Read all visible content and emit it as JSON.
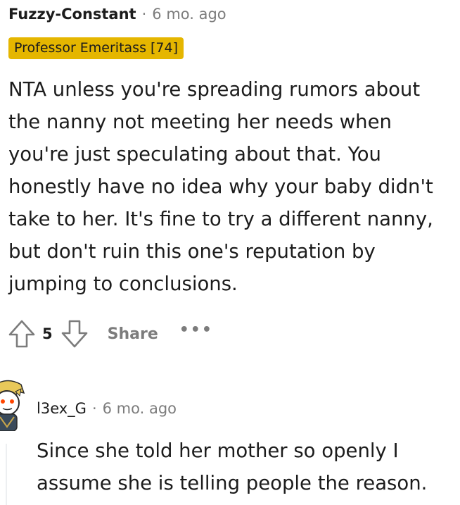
{
  "comment": {
    "author": "Fuzzy-Constant",
    "separator": "·",
    "time": "6 mo. ago",
    "flair": "Professor Emeritass [74]",
    "body": "NTA unless you're spreading rumors about the nanny not meeting her needs when you're just speculating about that. You honestly have no idea why your baby didn't take to her. It's fine to try a different nanny, but don't ruin this one's reputation by jumping to conclusions.",
    "score": "5",
    "share_label": "Share",
    "more_label": "•••"
  },
  "reply": {
    "author": "l3ex_G",
    "separator": "·",
    "time": "6 mo. ago",
    "body": "Since she told her mother so openly I assume she is telling people the reason."
  },
  "colors": {
    "flair_bg": "#e5b600",
    "muted": "#7c7c7c",
    "text": "#1c1c1c"
  },
  "icons": {
    "upvote": "upvote-arrow-icon",
    "downvote": "downvote-arrow-icon",
    "avatar": "user-avatar"
  }
}
